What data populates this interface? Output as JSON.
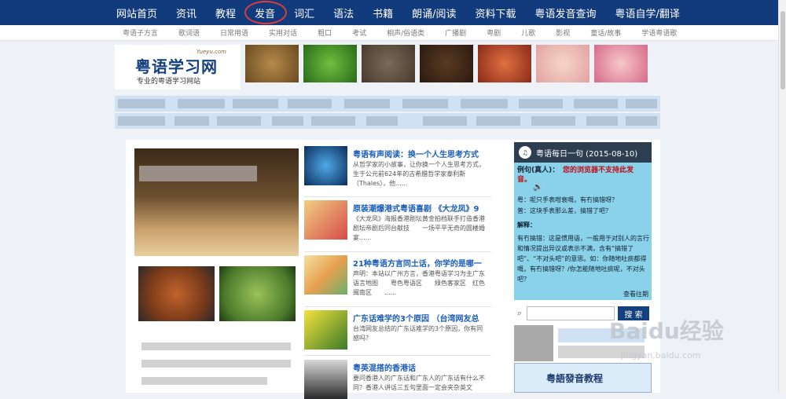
{
  "topnav": {
    "items": [
      "网站首页",
      "资讯",
      "教程",
      "发音",
      "词汇",
      "语法",
      "书籍",
      "朗诵/阅读",
      "资料下载",
      "粤语发音查询",
      "粤语自学/翻译"
    ]
  },
  "subnav": {
    "items": [
      "粤语子方言",
      "歌词语",
      "日常用语",
      "实用对话",
      "粗口",
      "考试",
      "相声/俗语类",
      "广播剧",
      "粤剧",
      "儿歌",
      "影视",
      "童话/故事",
      "学语粤语歌"
    ]
  },
  "logo": {
    "url_text": "Yueyu.com",
    "name": "粤语学习网",
    "tagline": "专业的粤语学习网站"
  },
  "articles": [
    {
      "title": "粤语有声阅读：换一个人生思考方式",
      "desc": "从哲学家的小故事，让你换一个人生思考方式，生于公元前624年的古希腊哲学家泰利斯（Thales），他......"
    },
    {
      "title": "原装潮爆港式粤语喜剧 《大龙凤》9",
      "desc": "《大龙凤》海报香港剧坛黄金拍档联手打造香港剧坛帝剧后同台献技　　一场平平无奇的圆楼婚宴......"
    },
    {
      "title": "21种粤语方言同土话，你学的是哪一",
      "desc": "声明：本站以广州方言，香港粤语学习为主广东语言地图　　粤色粤语区　　綠色客家区　红色闽南区　　......"
    },
    {
      "title": "广东话难学的3个原因 （台湾网友总",
      "desc": "台湾网友总结的广东话难学的3个原因，你有同感吗？"
    },
    {
      "title": "粤英混搭的香港话",
      "desc": "要问香港人的广东话和广东人的广东话有什么不同？香港人讲话三五句里面一定会夹杂英文"
    }
  ],
  "daily": {
    "title": "粤语每日一句 (2015-08-10)",
    "example_label": "例句(真人)：",
    "browser_warning": "您的浏览器不支持此发音。",
    "line1": "粤：呢只手表咁衰嘅，有冇搞错呀？",
    "line2": "普：这块手表那么差，搞错了吧？",
    "explain_label": "解释：",
    "explain": "有冇搞错：这是惯用语，一般用于对别人的言行和情况提出异议或表示不满，含有“搞错了吧”、“不对头吧”的意思。如：你随地吐痰都得嘅，有冇搞错呀？/你怎能随地吐痰呢，不对头吧？",
    "more": "查看往期"
  },
  "search": {
    "button": "搜 索"
  },
  "banner": {
    "text": "粤語發音教程"
  },
  "watermark": {
    "brand": "Baidu经验",
    "url": "jingyan.baidu.com"
  }
}
